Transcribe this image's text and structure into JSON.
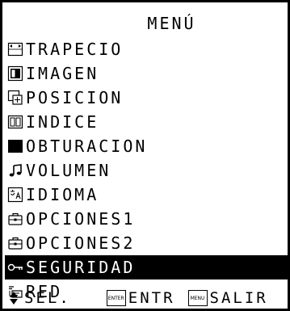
{
  "menu": {
    "title": "MENÚ",
    "items": [
      {
        "label": "TRAPECIO",
        "icon": "keystone-icon"
      },
      {
        "label": "IMAGEN",
        "icon": "picture-icon"
      },
      {
        "label": "POSICION",
        "icon": "position-icon"
      },
      {
        "label": "INDICE",
        "icon": "index-icon"
      },
      {
        "label": "OBTURACION",
        "icon": "shutter-icon"
      },
      {
        "label": "VOLUMEN",
        "icon": "music-note-icon"
      },
      {
        "label": "IDIOMA",
        "icon": "language-icon"
      },
      {
        "label": "OPCIONES1",
        "icon": "options-icon"
      },
      {
        "label": "OPCIONES2",
        "icon": "options-icon"
      },
      {
        "label": "SEGURIDAD",
        "icon": "key-icon",
        "selected": true
      },
      {
        "label": "RED",
        "icon": "network-icon"
      }
    ]
  },
  "footer": {
    "select_label": "SEL.",
    "enter_key": "ENTER",
    "enter_label": "ENTR",
    "menu_key": "MENU",
    "exit_label": "SALIR"
  }
}
